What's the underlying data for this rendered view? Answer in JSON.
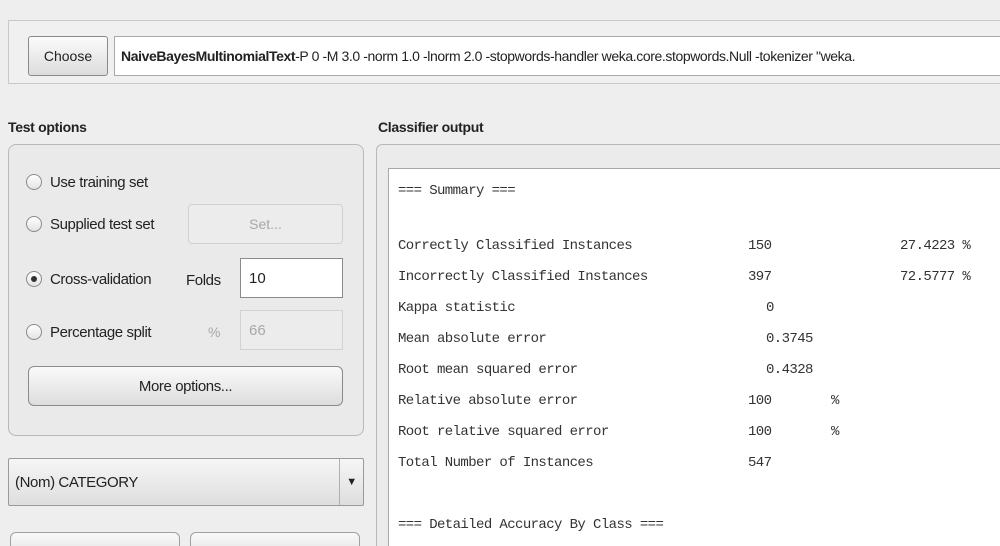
{
  "classifier": {
    "choose_label": "Choose",
    "scheme_name": "NaiveBayesMultinomialText",
    "scheme_options": " -P 0 -M 3.0 -norm 1.0 -lnorm 2.0 -stopwords-handler weka.core.stopwords.Null -tokenizer \"weka."
  },
  "test_options": {
    "title": "Test options",
    "use_training_set": "Use training set",
    "supplied_test_set": "Supplied test set",
    "set_button": "Set...",
    "cross_validation": "Cross-validation",
    "folds_label": "Folds",
    "folds_value": "10",
    "percentage_split": "Percentage split",
    "percent_sign": "%",
    "percent_value": "66",
    "selected": "cross_validation",
    "more_options": "More options..."
  },
  "class_attribute": {
    "value": "(Nom) CATEGORY"
  },
  "output": {
    "title": "Classifier output",
    "summary_header": "=== Summary ===",
    "rows": [
      {
        "label": "Correctly Classified Instances",
        "value": "150",
        "percent": "27.4223 %"
      },
      {
        "label": "Incorrectly Classified Instances",
        "value": "397",
        "percent": "72.5777 %"
      },
      {
        "label": "Kappa statistic",
        "value": "0"
      },
      {
        "label": "Mean absolute error",
        "value": "0.3745"
      },
      {
        "label": "Root mean squared error",
        "value": "0.4328"
      },
      {
        "label": "Relative absolute error",
        "value": "100",
        "unit": "%"
      },
      {
        "label": "Root relative squared error",
        "value": "100",
        "unit": "%"
      },
      {
        "label": "Total Number of Instances",
        "value": "547"
      }
    ],
    "detailed_header": "=== Detailed Accuracy By Class ==="
  }
}
